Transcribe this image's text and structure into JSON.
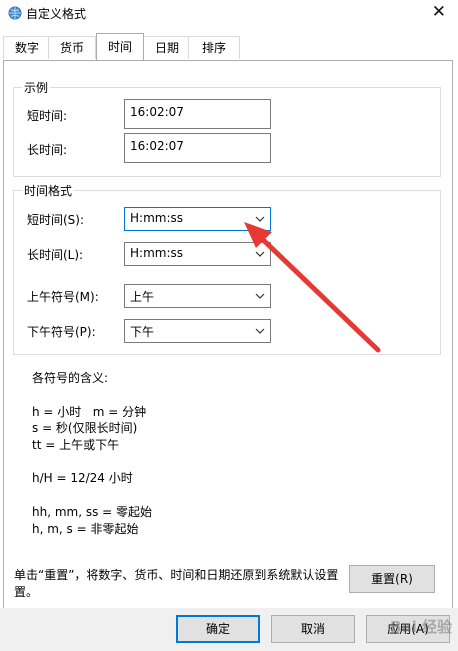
{
  "window": {
    "title": "自定义格式",
    "close_glyph": "✕"
  },
  "tabs": [
    {
      "label": "数字",
      "active": false
    },
    {
      "label": "货币",
      "active": false
    },
    {
      "label": "时间",
      "active": true
    },
    {
      "label": "日期",
      "active": false
    },
    {
      "label": "排序",
      "active": false
    }
  ],
  "example": {
    "group_title": "示例",
    "short_label": "短时间:",
    "short_value": "16:02:07",
    "long_label": "长时间:",
    "long_value": "16:02:07"
  },
  "time_formats": {
    "group_title": "时间格式",
    "rows": [
      {
        "label": "短时间(S):",
        "value": "H:mm:ss"
      },
      {
        "label": "长时间(L):",
        "value": "H:mm:ss"
      },
      {
        "label": "上午符号(M):",
        "value": "上午"
      },
      {
        "label": "下午符号(P):",
        "value": "下午"
      }
    ]
  },
  "legend": {
    "heading": "各符号的含义:",
    "lines": [
      "h = 小时   m = 分钟",
      "s = 秒(仅限长时间)",
      "tt = 上午或下午",
      "h/H = 12/24 小时",
      "hh, mm, ss = 零起始",
      "h, m, s = 非零起始"
    ]
  },
  "reset": {
    "note_line1": "单击“重置”，将数字、货币、时间和日期还原到系统默认设置",
    "note_line2": "置。",
    "button": "重置(R)"
  },
  "buttons": {
    "ok": "确定",
    "cancel": "取消",
    "apply": "应用(A)"
  },
  "watermark": "Bai 经验",
  "colors": {
    "accent": "#0078d7",
    "annotation_arrow": "#e53935"
  },
  "icons": {
    "app": "globe-clock-icon",
    "chevron": "chevron-down-icon",
    "close": "close-icon"
  }
}
